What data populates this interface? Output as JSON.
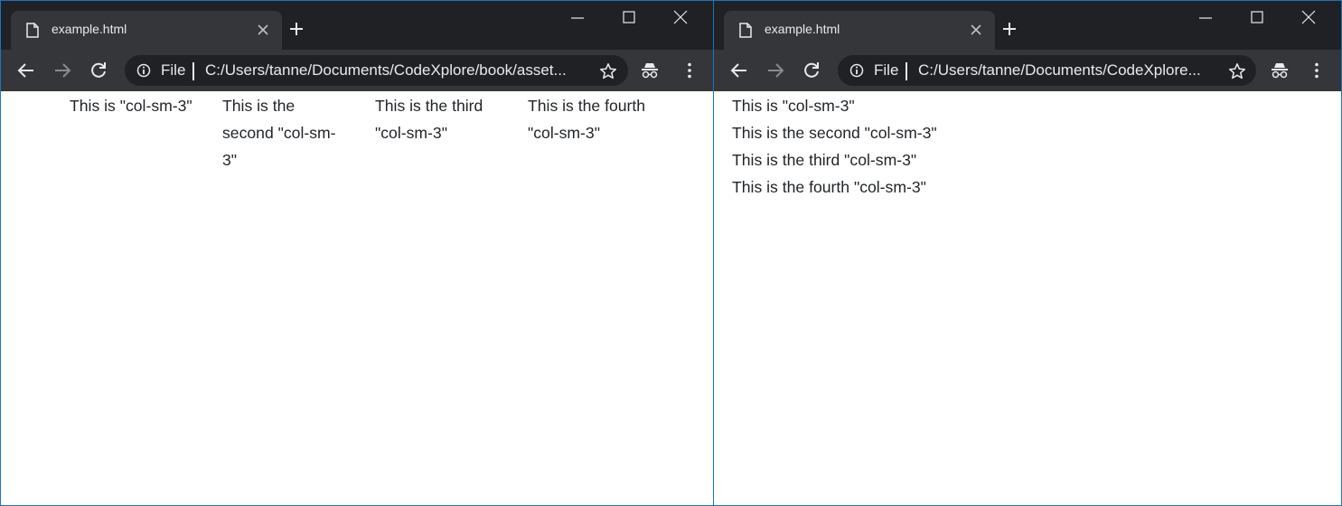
{
  "windows": [
    {
      "tab_title": "example.html",
      "omnibox": {
        "scheme_label": "File",
        "url": "C:/Users/tanne/Documents/CodeXplore/book/asset..."
      },
      "content": {
        "layout": "columns",
        "columns": [
          "This is \"col-sm-3\"",
          "This is the second \"col-sm-3\"",
          "This is the third \"col-sm-3\"",
          "This is the fourth \"col-sm-3\""
        ]
      }
    },
    {
      "tab_title": "example.html",
      "omnibox": {
        "scheme_label": "File",
        "url": "C:/Users/tanne/Documents/CodeXplore..."
      },
      "content": {
        "layout": "stacked",
        "columns": [
          "This is \"col-sm-3\"",
          "This is the second \"col-sm-3\"",
          "This is the third \"col-sm-3\"",
          "This is the fourth \"col-sm-3\""
        ]
      }
    }
  ],
  "colors": {
    "titlebar": "#202124",
    "toolbar": "#35363a",
    "omnibox": "#202124",
    "window_border": "#1e73be",
    "page_text": "#212529",
    "chrome_text": "#e8eaed",
    "disabled_icon": "#8a8b8e"
  },
  "icons": {
    "tab": "file-icon",
    "tab_close": "close-icon",
    "new_tab": "plus-icon",
    "minimize": "minimize-icon",
    "maximize": "maximize-icon",
    "close_window": "close-icon",
    "back": "arrow-left-icon",
    "forward": "arrow-right-icon",
    "reload": "reload-icon",
    "site_info": "info-icon",
    "bookmark": "star-icon",
    "incognito": "incognito-icon",
    "menu": "kebab-menu-icon"
  }
}
